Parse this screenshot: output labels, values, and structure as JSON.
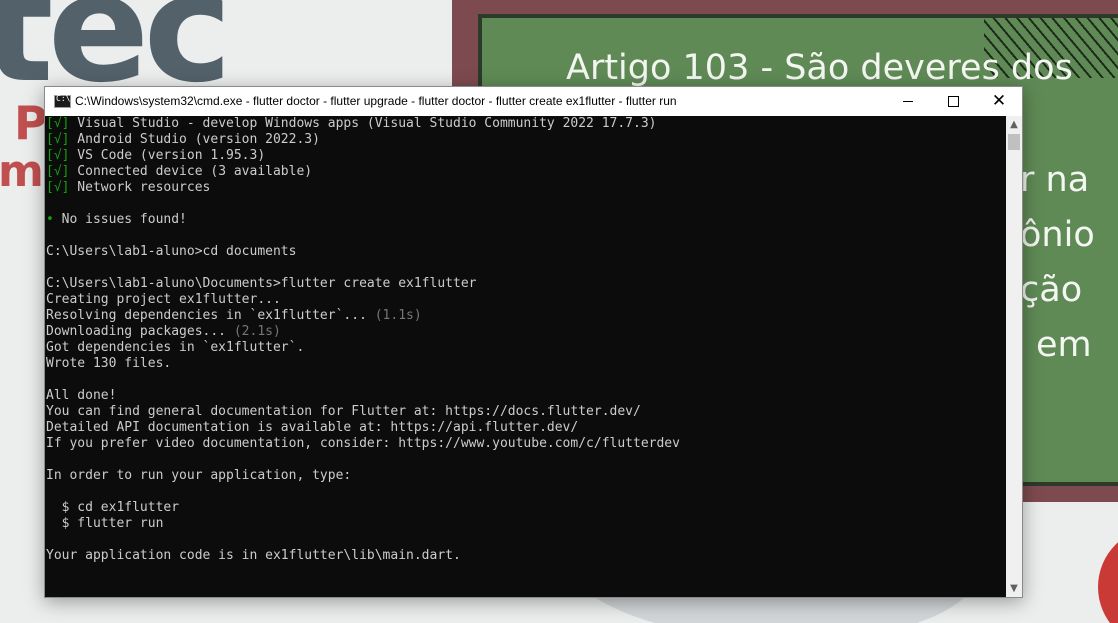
{
  "wallpaper": {
    "brand_text": "tec",
    "brand_p": "P",
    "brand_ma": "ma",
    "board_lines": [
      "Artigo 103 - São deveres dos",
      "r na",
      "ônio",
      "ção",
      "em"
    ],
    "colors": {
      "board": "#5f8a55",
      "frame": "#7d4b4f",
      "accent": "#c93a36"
    }
  },
  "window": {
    "title": "C:\\Windows\\system32\\cmd.exe - flutter  doctor - flutter  upgrade - flutter  doctor - flutter  create ex1flutter - flutter  run",
    "icon": "console-app-icon",
    "buttons": {
      "minimize": "minimize",
      "maximize": "maximize",
      "close": "✕"
    }
  },
  "console": {
    "lines": [
      {
        "pre": "",
        "mark": "[√]",
        "text": " Visual Studio - develop Windows apps (Visual Studio Community 2022 17.7.3)",
        "dim": ""
      },
      {
        "pre": "",
        "mark": "[√]",
        "text": " Android Studio (version 2022.3)",
        "dim": ""
      },
      {
        "pre": "",
        "mark": "[√]",
        "text": " VS Code (version 1.95.3)",
        "dim": ""
      },
      {
        "pre": "",
        "mark": "[√]",
        "text": " Connected device (3 available)",
        "dim": ""
      },
      {
        "pre": "",
        "mark": "[√]",
        "text": " Network resources",
        "dim": ""
      },
      {
        "pre": "",
        "mark": "",
        "text": "",
        "dim": ""
      },
      {
        "pre": "",
        "mark": "•",
        "text": " No issues found!",
        "dim": ""
      },
      {
        "pre": "",
        "mark": "",
        "text": "",
        "dim": ""
      },
      {
        "pre": "",
        "mark": "",
        "text": "C:\\Users\\lab1-aluno>cd documents",
        "dim": ""
      },
      {
        "pre": "",
        "mark": "",
        "text": "",
        "dim": ""
      },
      {
        "pre": "",
        "mark": "",
        "text": "C:\\Users\\lab1-aluno\\Documents>flutter create ex1flutter",
        "dim": ""
      },
      {
        "pre": "",
        "mark": "",
        "text": "Creating project ex1flutter...",
        "dim": ""
      },
      {
        "pre": "",
        "mark": "",
        "text": "Resolving dependencies in `ex1flutter`... ",
        "dim": "(1.1s)"
      },
      {
        "pre": "",
        "mark": "",
        "text": "Downloading packages... ",
        "dim": "(2.1s)"
      },
      {
        "pre": "",
        "mark": "",
        "text": "Got dependencies in `ex1flutter`.",
        "dim": ""
      },
      {
        "pre": "",
        "mark": "",
        "text": "Wrote 130 files.",
        "dim": ""
      },
      {
        "pre": "",
        "mark": "",
        "text": "",
        "dim": ""
      },
      {
        "pre": "",
        "mark": "",
        "text": "All done!",
        "dim": ""
      },
      {
        "pre": "",
        "mark": "",
        "text": "You can find general documentation for Flutter at: https://docs.flutter.dev/",
        "dim": ""
      },
      {
        "pre": "",
        "mark": "",
        "text": "Detailed API documentation is available at: https://api.flutter.dev/",
        "dim": ""
      },
      {
        "pre": "",
        "mark": "",
        "text": "If you prefer video documentation, consider: https://www.youtube.com/c/flutterdev",
        "dim": ""
      },
      {
        "pre": "",
        "mark": "",
        "text": "",
        "dim": ""
      },
      {
        "pre": "",
        "mark": "",
        "text": "In order to run your application, type:",
        "dim": ""
      },
      {
        "pre": "",
        "mark": "",
        "text": "",
        "dim": ""
      },
      {
        "pre": "",
        "mark": "",
        "text": "  $ cd ex1flutter",
        "dim": ""
      },
      {
        "pre": "",
        "mark": "",
        "text": "  $ flutter run",
        "dim": ""
      },
      {
        "pre": "",
        "mark": "",
        "text": "",
        "dim": ""
      },
      {
        "pre": "",
        "mark": "",
        "text": "Your application code is in ex1flutter\\lib\\main.dart.",
        "dim": ""
      },
      {
        "pre": "",
        "mark": "",
        "text": "",
        "dim": ""
      }
    ],
    "colors": {
      "text": "#cccccc",
      "ok": "#13a10e",
      "dim": "#767676",
      "background": "#0c0c0c"
    }
  },
  "scrollbar": {
    "up": "▲",
    "down": "▼"
  }
}
